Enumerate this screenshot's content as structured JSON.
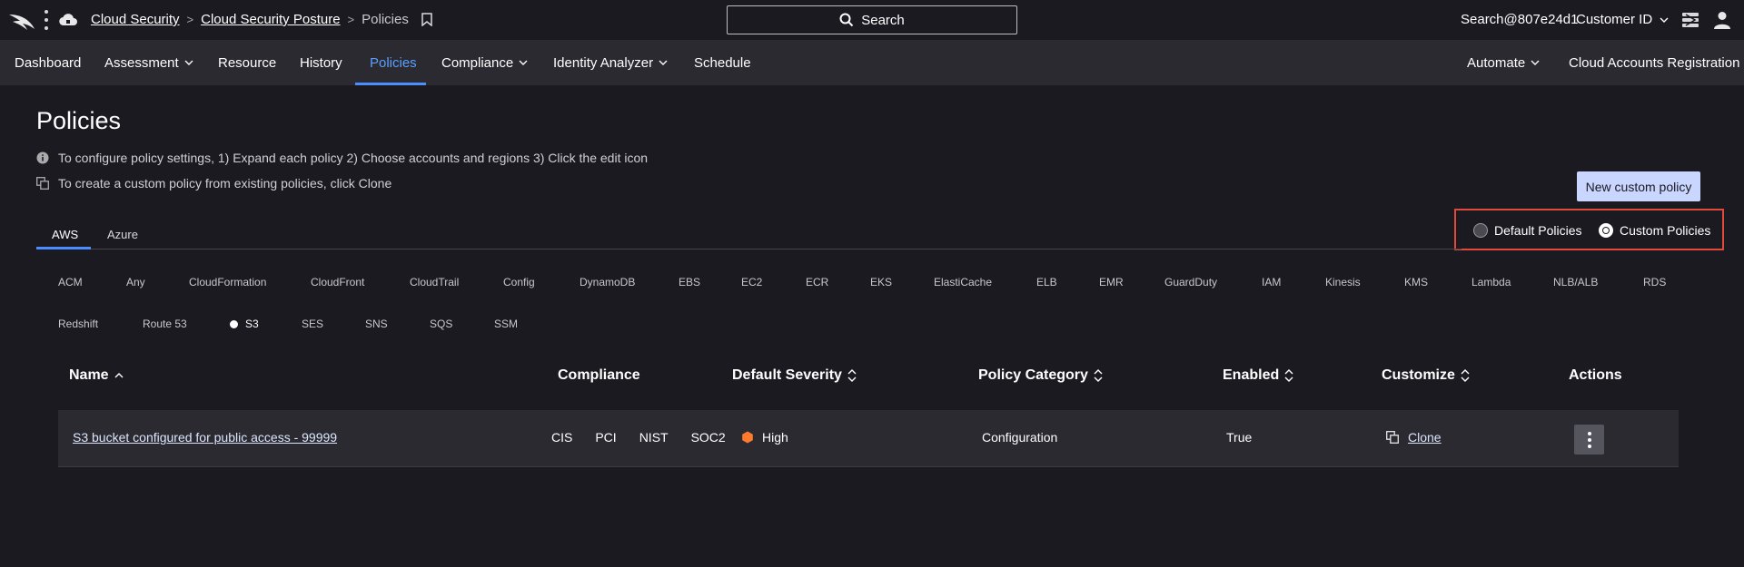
{
  "topbar": {
    "breadcrumb": [
      "Cloud Security",
      "Cloud Security Posture",
      "Policies"
    ],
    "search_label": "Search",
    "user": "Search@807e24d1",
    "customer_id_label": "Customer ID"
  },
  "nav": {
    "items": [
      {
        "label": "Dashboard",
        "has_menu": false
      },
      {
        "label": "Assessment",
        "has_menu": true
      },
      {
        "label": "Resource",
        "has_menu": false
      },
      {
        "label": "History",
        "has_menu": false
      },
      {
        "label": "Policies",
        "has_menu": false,
        "active": true
      },
      {
        "label": "Compliance",
        "has_menu": true
      },
      {
        "label": "Identity Analyzer",
        "has_menu": true
      },
      {
        "label": "Schedule",
        "has_menu": false
      }
    ],
    "right_items": [
      {
        "label": "Automate",
        "has_menu": true
      },
      {
        "label": "Cloud Accounts Registration",
        "has_menu": false
      }
    ]
  },
  "page": {
    "title": "Policies",
    "info_text": "To configure policy settings, 1) Expand each policy 2) Choose accounts and regions 3) Click the edit icon",
    "clone_text": "To create a custom policy from existing policies, click Clone",
    "new_policy_button": "New custom policy",
    "policy_type": {
      "options": [
        "Default Policies",
        "Custom Policies"
      ],
      "selected": "Custom Policies"
    },
    "cloud_tabs": [
      "AWS",
      "Azure"
    ],
    "active_cloud_tab": "AWS",
    "services_row1": [
      "ACM",
      "Any",
      "CloudFormation",
      "CloudFront",
      "CloudTrail",
      "Config",
      "DynamoDB",
      "EBS",
      "EC2",
      "ECR",
      "EKS",
      "ElastiCache",
      "ELB",
      "EMR",
      "GuardDuty",
      "IAM",
      "Kinesis",
      "KMS",
      "Lambda",
      "NLB/ALB",
      "RDS"
    ],
    "services_row2": [
      "Redshift",
      "Route 53",
      "S3",
      "SES",
      "SNS",
      "SQS",
      "SSM"
    ],
    "selected_service": "S3"
  },
  "table": {
    "columns": [
      "Name",
      "Compliance",
      "Default Severity",
      "Policy Category",
      "Enabled",
      "Customize",
      "Actions"
    ],
    "rows": [
      {
        "name": "S3 bucket configured for public access - 99999",
        "compliance": [
          "CIS",
          "PCI",
          "NIST",
          "SOC2"
        ],
        "severity": "High",
        "category": "Configuration",
        "enabled": "True",
        "customize": "Clone"
      }
    ]
  },
  "colors": {
    "accent": "#4c8dff",
    "severity_high": "#ff7a2e",
    "highlight_box": "#e04a3c",
    "button_bg": "#c9d6ff"
  }
}
